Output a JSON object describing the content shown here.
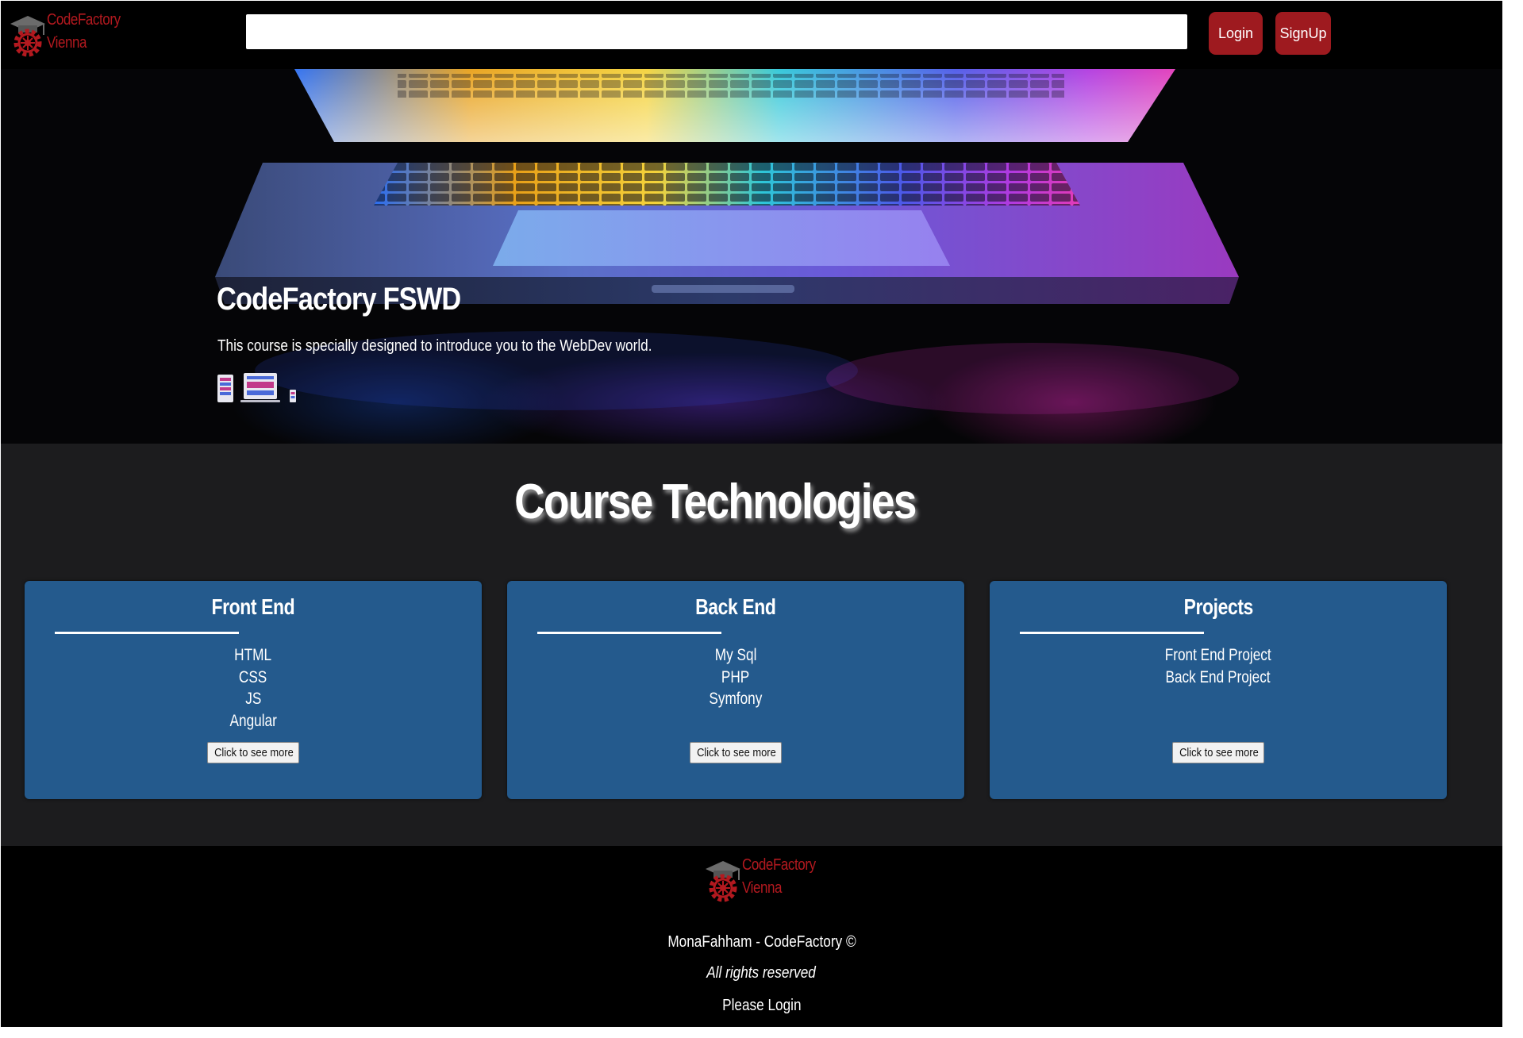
{
  "header": {
    "logo": {
      "line1": "CodeFactory",
      "line2": "Vienna"
    },
    "search": {
      "value": "",
      "placeholder": ""
    },
    "login_label": "Login",
    "signup_label": "SignUp"
  },
  "hero": {
    "title": "CodeFactory FSWD",
    "subtitle": "This course is specially designed to introduce you to the WebDev world."
  },
  "technologies": {
    "heading": "Course Technologies",
    "cards": [
      {
        "title": "Front End",
        "items": [
          "HTML",
          "CSS",
          "JS",
          "Angular"
        ],
        "button_label": "Click to see more"
      },
      {
        "title": "Back End",
        "items": [
          "My Sql",
          "PHP",
          "Symfony"
        ],
        "button_label": "Click to see more"
      },
      {
        "title": "Projects",
        "items": [
          "Front End Project",
          "Back End Project"
        ],
        "button_label": "Click to see more"
      }
    ]
  },
  "footer": {
    "logo": {
      "line1": "CodeFactory",
      "line2": "Vienna"
    },
    "copyright": "MonaFahham - CodeFactory ©",
    "rights": "All rights reserved",
    "login_status": "Please Login"
  },
  "colors": {
    "brand_red": "#b3191f",
    "button_red": "#9e1a1f",
    "card_blue": "#245a8d",
    "section_background": "#1c1c1e",
    "header_footer_background": "#000000"
  },
  "icons": {
    "logo": "graduation-cap-gear-logo",
    "hero": "responsive-devices-icon"
  }
}
